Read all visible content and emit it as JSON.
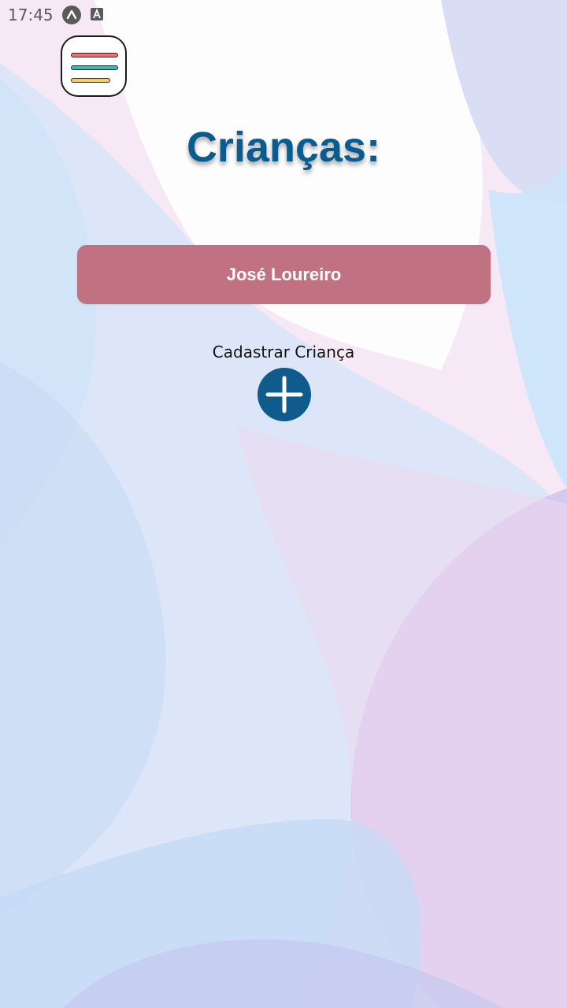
{
  "status_bar": {
    "time": "17:45",
    "icons": [
      "app-notification-icon",
      "accessibility-icon"
    ]
  },
  "menu": {
    "icon": "hamburger-menu-icon",
    "line_colors": [
      "#ef6f6a",
      "#3fb6b3",
      "#f4cc6a"
    ]
  },
  "header": {
    "title": "Crianças:"
  },
  "children": [
    {
      "name": "José Loureiro"
    }
  ],
  "register": {
    "label": "Cadastrar Criança",
    "icon": "plus-circle-icon"
  },
  "colors": {
    "title": "#0b5c8e",
    "card": "#c07282",
    "add_button": "#0e5b8c"
  }
}
